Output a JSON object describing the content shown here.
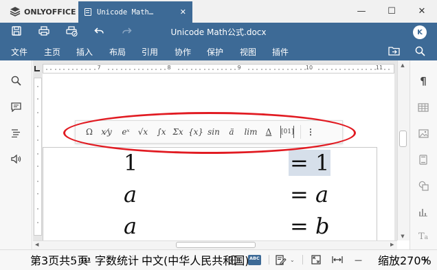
{
  "app": {
    "brand": "ONLYOFFICE"
  },
  "tab": {
    "label": "Unicode Math…",
    "close": "✕"
  },
  "window": {
    "minimize": "—",
    "maximize": "☐",
    "close": "✕"
  },
  "document": {
    "title": "Unicode Math公式.docx"
  },
  "user": {
    "initial": "K"
  },
  "menu": [
    "文件",
    "主页",
    "插入",
    "布局",
    "引用",
    "协作",
    "保护",
    "视图",
    "插件"
  ],
  "ruler": {
    "numbers": [
      "7",
      "8",
      "9",
      "10",
      "11"
    ]
  },
  "equation_toolbar": {
    "items": [
      "Ω",
      "x⁄y",
      "eˣ",
      "√x",
      "∫x",
      "Σx",
      "{x}",
      "sin",
      "ä",
      "lim",
      "Δ",
      "[01]",
      "⋮"
    ]
  },
  "equations": [
    {
      "lhs": "1",
      "rhs": "= 1",
      "lhs_italic": false,
      "rhs_italic": false,
      "selected": true
    },
    {
      "lhs": "a",
      "rhs": "= a",
      "lhs_italic": true,
      "rhs_italic": true,
      "selected": false
    },
    {
      "lhs": "a",
      "rhs": "= b",
      "lhs_italic": true,
      "rhs_italic": true,
      "selected": false
    }
  ],
  "status": {
    "page": "第3页共5页",
    "word_count_icon": "123",
    "word_count": "字数统计",
    "language": "中文(中华人民共和国)",
    "spell_icon": "ABC",
    "zoom": "缩放270%",
    "zoom_out": "—",
    "zoom_in": "+"
  },
  "colors": {
    "accent": "#3d6a96",
    "annotation": "#e11b22",
    "selection": "#d6dfea"
  }
}
